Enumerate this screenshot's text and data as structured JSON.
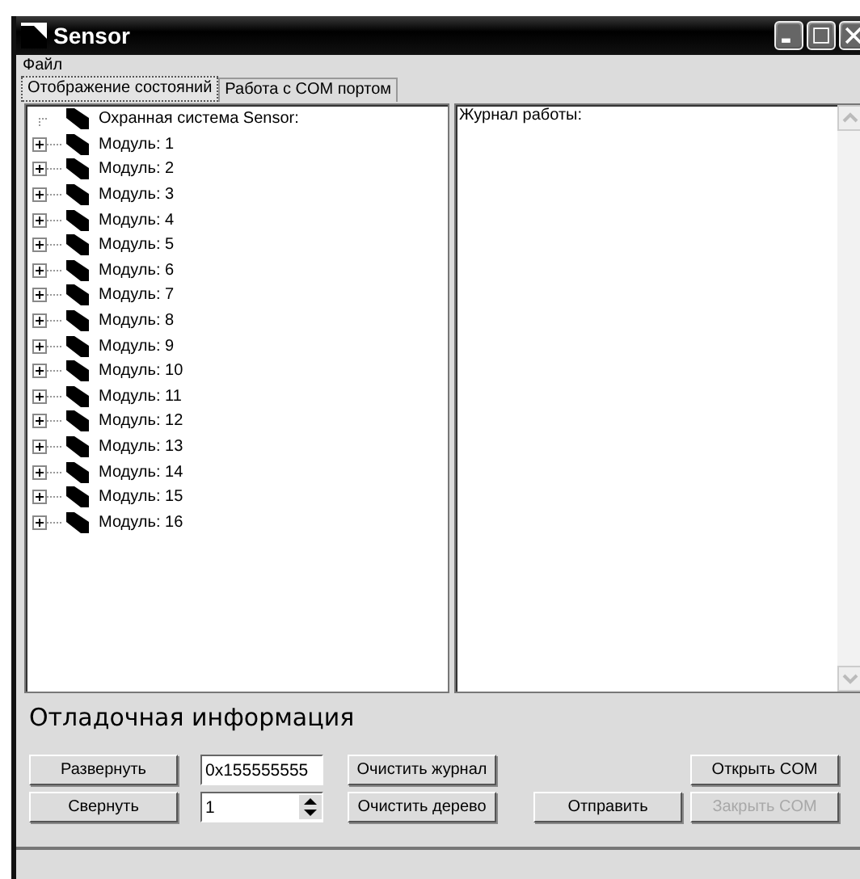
{
  "window": {
    "title": "Sensor"
  },
  "menu": [
    {
      "label": "Файл"
    }
  ],
  "tabs": [
    {
      "label": "Отображение состояний",
      "selected": true
    },
    {
      "label": "Работа с COM портом",
      "selected": false
    }
  ],
  "tree": {
    "label": "Охранная система Sensor:",
    "children": [
      {
        "label": "Модуль: 1",
        "expanded": false
      },
      {
        "label": "Модуль: 2",
        "expanded": false
      },
      {
        "label": "Модуль: 3",
        "expanded": false
      },
      {
        "label": "Модуль: 4",
        "expanded": false
      },
      {
        "label": "Модуль: 5",
        "expanded": false
      },
      {
        "label": "Модуль: 6",
        "expanded": false
      },
      {
        "label": "Модуль: 7",
        "expanded": false
      },
      {
        "label": "Модуль: 8",
        "expanded": false
      },
      {
        "label": "Модуль: 9",
        "expanded": false
      },
      {
        "label": "Модуль: 10",
        "expanded": false
      },
      {
        "label": "Модуль: 11",
        "expanded": false
      },
      {
        "label": "Модуль: 12",
        "expanded": false
      },
      {
        "label": "Модуль: 13",
        "expanded": false
      },
      {
        "label": "Модуль: 14",
        "expanded": false
      },
      {
        "label": "Модуль: 15",
        "expanded": false
      },
      {
        "label": "Модуль: 16",
        "expanded": false
      }
    ]
  },
  "log": {
    "text": "Журнал работы:"
  },
  "debug": {
    "title": "Отладочная информация",
    "expand_button": {
      "label": "Развернуть",
      "disabled": false
    },
    "collapse_button": {
      "label": "Свернуть",
      "disabled": false
    },
    "address_field": {
      "value": "0x155555555"
    },
    "count_spinner": {
      "value": "1"
    },
    "clear_log_button": {
      "label": "Очистить журнал",
      "disabled": false
    },
    "clear_tree_button": {
      "label": "Очистить дерево",
      "disabled": false
    },
    "send_button": {
      "label": "Отправить",
      "disabled": false
    },
    "open_com_button": {
      "label": "Открыть COM",
      "disabled": false
    },
    "close_com_button": {
      "label": "Закрыть COM",
      "disabled": true
    }
  }
}
